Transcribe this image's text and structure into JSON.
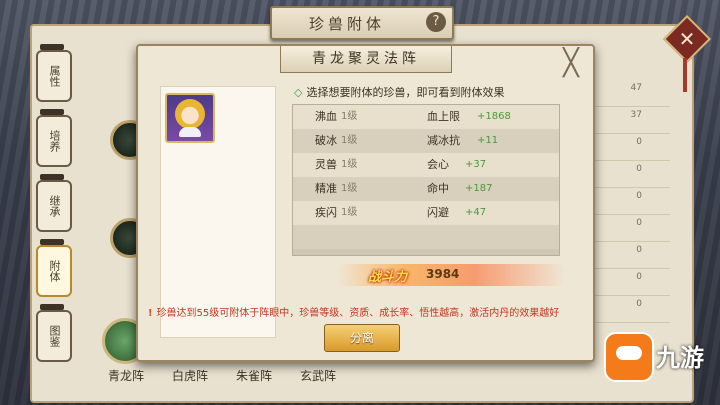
{
  "top_title": "珍兽附体",
  "help_icon": "?",
  "close_icon": "✕",
  "side_tabs": [
    "属性",
    "培养",
    "继承",
    "附体",
    "图鉴"
  ],
  "side_active": "附体",
  "bg_values": [
    "47",
    "37",
    "0",
    "0",
    "0",
    "0",
    "0",
    "0",
    "0"
  ],
  "bottom_tabs": [
    "青龙阵",
    "白虎阵",
    "朱雀阵",
    "玄武阵"
  ],
  "dialog": {
    "title": "青龙聚灵法阵",
    "close_icon": "╳",
    "hint": "选择想要附体的珍兽，即可看到附体效果",
    "rows": [
      {
        "name": "沸血",
        "level": "1级",
        "attr": "血上限",
        "value": "+1868"
      },
      {
        "name": "破冰",
        "level": "1级",
        "attr": "减冰抗",
        "value": "+11"
      },
      {
        "name": "灵兽",
        "level": "1级",
        "attr": "会心",
        "value": "+37"
      },
      {
        "name": "精准",
        "level": "1级",
        "attr": "命中",
        "value": "+187"
      },
      {
        "name": "疾闪",
        "level": "1级",
        "attr": "闪避",
        "value": "+47"
      }
    ],
    "power_label": "战斗力",
    "power_value": "3984",
    "warning": "珍兽达到55级可附体于阵眼中，珍兽等级、资质、成长率、悟性越高，激活内丹的效果越好",
    "warning_icon": "!",
    "split_button": "分离"
  },
  "watermark": "九游"
}
